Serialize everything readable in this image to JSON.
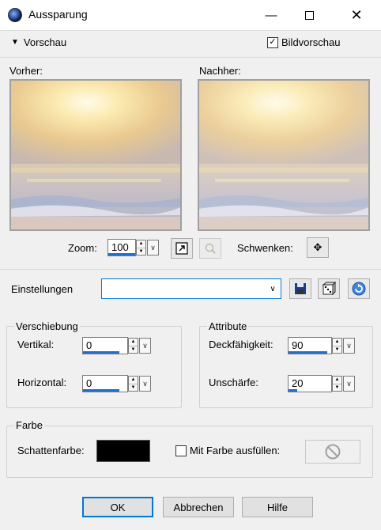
{
  "window": {
    "title": "Aussparung"
  },
  "preview": {
    "toggle_label": "Vorschau",
    "bildvorschau_label": "Bildvorschau",
    "bildvorschau_checked": true,
    "before_label": "Vorher:",
    "after_label": "Nachher:",
    "zoom_label": "Zoom:",
    "zoom_value": "100",
    "pan_label": "Schwenken:"
  },
  "settings": {
    "label": "Einstellungen",
    "value": ""
  },
  "offset": {
    "title": "Verschiebung",
    "vertical_label": "Vertikal:",
    "vertical_value": "0",
    "horizontal_label": "Horizontal:",
    "horizontal_value": "0"
  },
  "attributes": {
    "title": "Attribute",
    "opacity_label": "Deckfähigkeit:",
    "opacity_value": "90",
    "blur_label": "Unschärfe:",
    "blur_value": "20"
  },
  "color": {
    "title": "Farbe",
    "shadow_label": "Schattenfarbe:",
    "shadow_color": "#000000",
    "fill_label": "Mit Farbe ausfüllen:",
    "fill_checked": false
  },
  "buttons": {
    "ok": "OK",
    "cancel": "Abbrechen",
    "help": "Hilfe"
  },
  "colors": {
    "accent": "#1e6fd0",
    "default_button_border": "#0078d7"
  }
}
